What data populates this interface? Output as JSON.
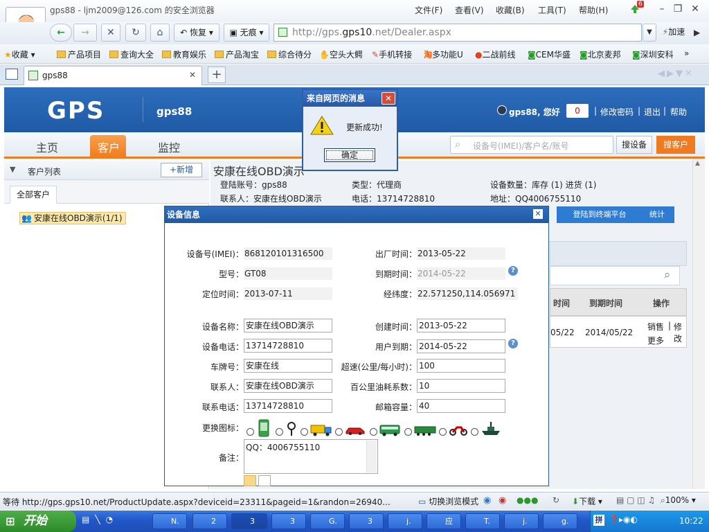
{
  "window": {
    "title": "gps88 - ljm2009@126.com 的安全浏览器",
    "menu": [
      "文件(F)",
      "查看(V)",
      "收藏(B)",
      "工具(T)",
      "帮助(H)"
    ],
    "badge": "6"
  },
  "nav": {
    "back": "←",
    "forward": "→",
    "stop": "✕",
    "refresh": "↻",
    "home": "⌂",
    "restore_label": "恢复",
    "notrace_label": "无痕",
    "url_prefix": "http://gps.",
    "url_host": "gps10",
    "url_suffix": ".net/Dealer.aspx",
    "accel": "加速"
  },
  "bookmarks": {
    "fav": "收藏",
    "items": [
      "产品项目",
      "查询大全",
      "教育娱乐",
      "产品淘宝",
      "综合待分",
      "空头大鳄",
      "手机转接",
      "多功能U",
      "二战前线",
      "CEM华盛",
      "北京麦邦",
      "深圳安科"
    ]
  },
  "tab": {
    "title": "gps88",
    "plus": "+"
  },
  "site": {
    "logo": "GPS",
    "user": "gps88",
    "greeting": "gps88, 您好",
    "msg_count": "0",
    "links": [
      "修改密码",
      "退出",
      "帮助"
    ],
    "tabs": [
      "主页",
      "客户",
      "监控"
    ],
    "search_placeholder": "设备号(IMEI)/客户名/账号",
    "search_btn": "搜设备",
    "search_customer_btn": "搜客户"
  },
  "sidebar": {
    "title": "客户列表",
    "add": "+新增",
    "tab": "全部客户",
    "node": "安康在线OBD演示(1/1)"
  },
  "customer": {
    "name": "安康在线OBD演示",
    "login_label": "登陆账号：",
    "login": "gps88",
    "type_label": "类型：",
    "type": "代理商",
    "devcount_label": "设备数量：",
    "devcount": "库存 (1) 进货 (1)",
    "contact_label": "联系人：",
    "contact": "安康在线OBD演示",
    "phone_label": "电话：",
    "phone": "13714728810",
    "addr_label": "地址：",
    "addr": "QQ4006755110",
    "btn_login": "登陆到终端平台",
    "btn_stats": "统计"
  },
  "table": {
    "headers": [
      "时间",
      "到期时间",
      "操作"
    ],
    "row": {
      "time": "05/22",
      "expire": "2014/05/22",
      "actions": [
        "销售",
        "修改",
        "更多"
      ],
      "sep": "|"
    }
  },
  "dialog": {
    "title": "设备信息",
    "close": "✕",
    "fields": {
      "imei_label": "设备号(IMEI)：",
      "imei": "868120101316500",
      "model_label": "型号：",
      "model": "GT08",
      "pos_label": "定位时间：",
      "pos_time": "2013-07-11",
      "factory_label": "出厂时间：",
      "factory": "2013-05-22",
      "expire_label": "到期时间：",
      "expire": "2014-05-22",
      "coord_label": "经纬度：",
      "coord": "22.571250,114.056971",
      "name_label": "设备名称：",
      "name": "安康在线OBD演示",
      "phone_label": "设备电话：",
      "phone": "13714728810",
      "plate_label": "车牌号：",
      "plate": "安康在线",
      "contact_label": "联系人：",
      "contact": "安康在线OBD演示",
      "cphone_label": "联系电话：",
      "cphone": "13714728810",
      "created_label": "创建时间：",
      "created": "2013-05-22",
      "uexpire_label": "用户到期：",
      "uexpire": "2014-05-22",
      "speed_label": "超速(公里/每小时)：",
      "speed": "100",
      "fuel_label": "百公里油耗系数：",
      "fuel": "10",
      "mail_label": "邮箱容量：",
      "mail": "40",
      "icon_label": "更换图标：",
      "remark_label": "备注：",
      "remark": "QQ：4006755110"
    }
  },
  "msgbox": {
    "title": "来自网页的消息",
    "text": "更新成功!",
    "ok": "确定",
    "close": "✕"
  },
  "status": {
    "url": "等待 http://gps.gps10.net/ProductUpdate.aspx?deviceid=23311&pageid=1&randon=26940...",
    "mode": "切换浏览模式",
    "download": "下载",
    "zoom": "100%"
  },
  "taskbar": {
    "start": "开始",
    "items": [
      "N.",
      "2",
      "3",
      "3",
      "G.",
      "3",
      "j.",
      "应",
      "T.",
      "j.",
      "g."
    ],
    "time": "10:22",
    "ime": "拼"
  },
  "colors": {
    "header": "#2163b3",
    "orange": "#f07a1f",
    "blue": "#1e5aa0"
  }
}
